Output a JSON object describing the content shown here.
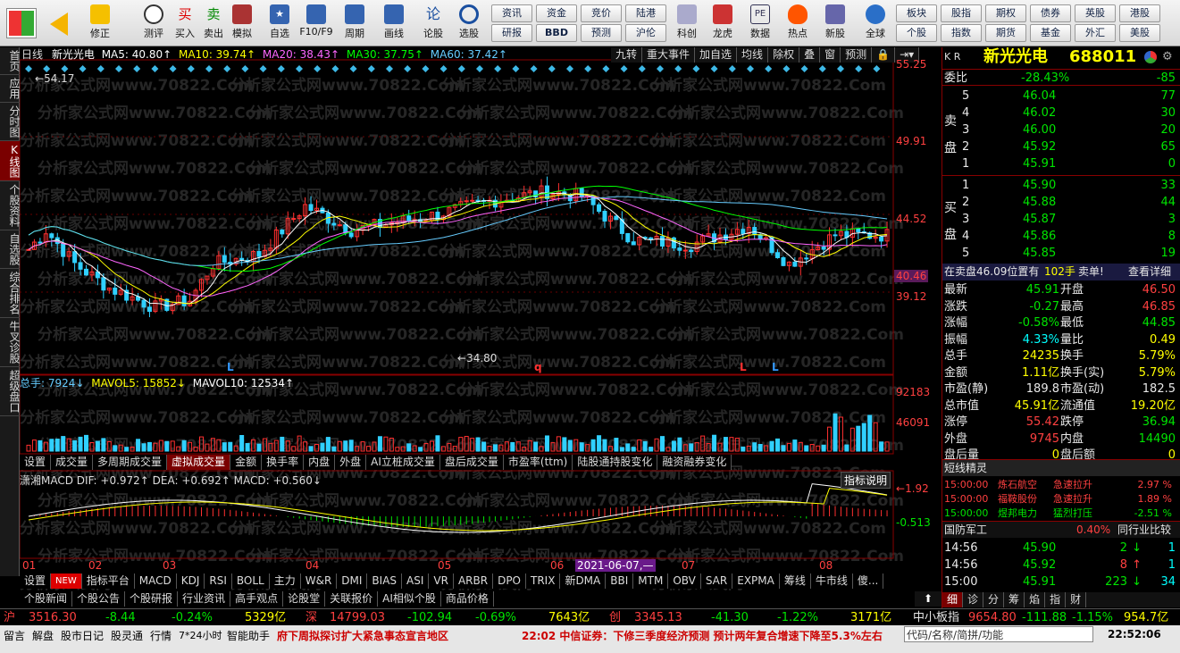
{
  "toolbar": {
    "buttons": [
      "修正",
      "测评",
      "买入",
      "卖出",
      "模拟",
      "自选",
      "F10/F9",
      "周期",
      "画线",
      "论股",
      "选股"
    ],
    "grid1": [
      "资讯",
      "资金",
      "竞价",
      "陆港"
    ],
    "grid2": [
      "研报",
      "BBD",
      "预测",
      "沪伦"
    ],
    "buttons2": [
      "科创",
      "龙虎",
      "数据",
      "热点",
      "新股",
      "全球"
    ],
    "grid3": [
      "板块",
      "股指",
      "期权",
      "债券",
      "英股",
      "港股"
    ],
    "grid4": [
      "个股",
      "指数",
      "期货",
      "基金",
      "外汇",
      "美股"
    ]
  },
  "leftnav": [
    "首页",
    "应用",
    "分时图",
    "K线图",
    "个股资料",
    "自选股",
    "综合排名",
    "牛叉诊股",
    "超级盘口"
  ],
  "chart": {
    "period": "日线",
    "stock": "新光光电",
    "ma": [
      "MA5: 40.80↑",
      "MA10: 39.74↑",
      "MA20: 38.43↑",
      "MA30: 37.75↑",
      "MA60: 37.42↑"
    ],
    "menu": [
      "九转",
      "重大事件",
      "加自选",
      "均线",
      "除权",
      "叠",
      "窗",
      "预测"
    ],
    "axis": [
      "55.25",
      "49.91",
      "44.52",
      "40.46",
      "39.12"
    ],
    "high": "54.17",
    "low": "34.80",
    "vol": {
      "label": "总手: 7924↓",
      "mavol5": "MAVOL5: 15852↓",
      "mavol10": "MAVOL10: 12534↑",
      "axis": [
        "92183",
        "46091"
      ]
    },
    "macd": {
      "label": "潇湘MACD DIF: +0.972↑ DEA: +0.692↑ MACD: +0.560↓",
      "axis": [
        "1.92",
        "0.513"
      ],
      "btn": "指标说明"
    },
    "months": [
      "01",
      "02",
      "03",
      "04",
      "05",
      "06",
      "07",
      "08"
    ],
    "date": "2021-06-07,—",
    "watermark": "分析家公式网www.70822.Com",
    "marks": [
      "L",
      "q",
      "L",
      "L"
    ]
  },
  "tabs1": [
    "设置",
    "成交量",
    "多周期成交量",
    "虚拟成交量",
    "金额",
    "换手率",
    "内盘",
    "外盘",
    "AI立桩成交量",
    "盘后成交量",
    "市盈率(ttm)",
    "陆股通持股变化",
    "融资融券变化"
  ],
  "tabs2": [
    "设置",
    "NEW",
    "指标平台",
    "MACD",
    "KDJ",
    "RSI",
    "BOLL",
    "主力",
    "W&R",
    "DMI",
    "BIAS",
    "ASI",
    "VR",
    "ARBR",
    "DPO",
    "TRIX",
    "新DMA",
    "BBI",
    "MTM",
    "OBV",
    "SAR",
    "EXPMA",
    "筹线",
    "牛市线",
    "傻..."
  ],
  "tabs3": [
    "个股新闻",
    "个股公告",
    "个股研报",
    "行业资讯",
    "高手观点",
    "论股堂",
    "关联报价",
    "AI相似个股",
    "商品价格"
  ],
  "quote": {
    "title": "新光光电",
    "code": "688011",
    "kr": "K R",
    "weibi": [
      "委比",
      "-28.43%",
      "-85"
    ],
    "sell": [
      [
        "5",
        "46.04",
        "77"
      ],
      [
        "4",
        "46.02",
        "30"
      ],
      [
        "3",
        "46.00",
        "20"
      ],
      [
        "2",
        "45.92",
        "65"
      ],
      [
        "1",
        "45.91",
        "0"
      ]
    ],
    "buy": [
      [
        "1",
        "45.90",
        "33"
      ],
      [
        "2",
        "45.88",
        "44"
      ],
      [
        "3",
        "45.87",
        "3"
      ],
      [
        "4",
        "45.86",
        "8"
      ],
      [
        "5",
        "45.85",
        "19"
      ]
    ],
    "sellLabel": [
      "卖",
      "盘"
    ],
    "buyLabel": [
      "买",
      "盘"
    ],
    "pending": [
      "在卖盘46.09位置有",
      "102手",
      "卖单!",
      "查看详细"
    ],
    "stats": [
      [
        "最新",
        "45.91",
        "开盘",
        "46.50"
      ],
      [
        "涨跌",
        "-0.27",
        "最高",
        "46.85"
      ],
      [
        "涨幅",
        "-0.58%",
        "最低",
        "44.85"
      ],
      [
        "振幅",
        "4.33%",
        "量比",
        "0.49"
      ],
      [
        "总手",
        "24235",
        "换手",
        "5.79%"
      ],
      [
        "金额",
        "1.11亿",
        "换手(实)",
        "5.79%"
      ],
      [
        "市盈(静)",
        "189.8",
        "市盈(动)",
        "182.5"
      ],
      [
        "总市值",
        "45.91亿",
        "流通值",
        "19.20亿"
      ],
      [
        "涨停",
        "55.42",
        "跌停",
        "36.94"
      ],
      [
        "外盘",
        "9745",
        "内盘",
        "14490"
      ],
      [
        "盘后量",
        "0",
        "盘后额",
        "0"
      ]
    ],
    "sprite": "短线精灵",
    "events": [
      [
        "15:00:00",
        "炼石航空",
        "急速拉升",
        "2.97 %"
      ],
      [
        "15:00:00",
        "福鞍股份",
        "急速拉升",
        "1.89 %"
      ],
      [
        "15:00:00",
        "煜邦电力",
        "猛烈打压",
        "-2.51 %"
      ]
    ],
    "sector": [
      "国防军工",
      "0.40%",
      "同行业比较"
    ],
    "ticks": [
      [
        "14:56",
        "45.90",
        "2",
        "1"
      ],
      [
        "14:56",
        "45.92",
        "8",
        "1"
      ],
      [
        "15:00",
        "45.91",
        "223",
        "34"
      ]
    ],
    "bottomTabs": [
      "细",
      "诊",
      "分",
      "筹",
      "焰",
      "指",
      "财"
    ]
  },
  "index": {
    "sh": [
      "沪",
      "3516.30",
      "-8.44",
      "-0.24%",
      "5329亿"
    ],
    "sz": [
      "深",
      "14799.03",
      "-102.94",
      "-0.69%",
      "7643亿"
    ],
    "cy": [
      "创",
      "3345.13",
      "-41.30",
      "-1.22%",
      "3171亿"
    ],
    "zx": [
      "中小板指",
      "9654.80",
      "-111.88",
      "-1.15%",
      "954.7亿"
    ]
  },
  "status": {
    "items": [
      "留言",
      "解盘",
      "股市日记",
      "股灵通",
      "行情",
      "7*24小时",
      "智能助手"
    ],
    "news1": "府下周拟探讨扩大紧急事态宣言地区",
    "news2": "22:02 中信证券：下修三季度经济预测 预计两年复合增速下降至5.3%左右",
    "search": "代码/名称/简拼/功能",
    "time": "22:52:06"
  }
}
